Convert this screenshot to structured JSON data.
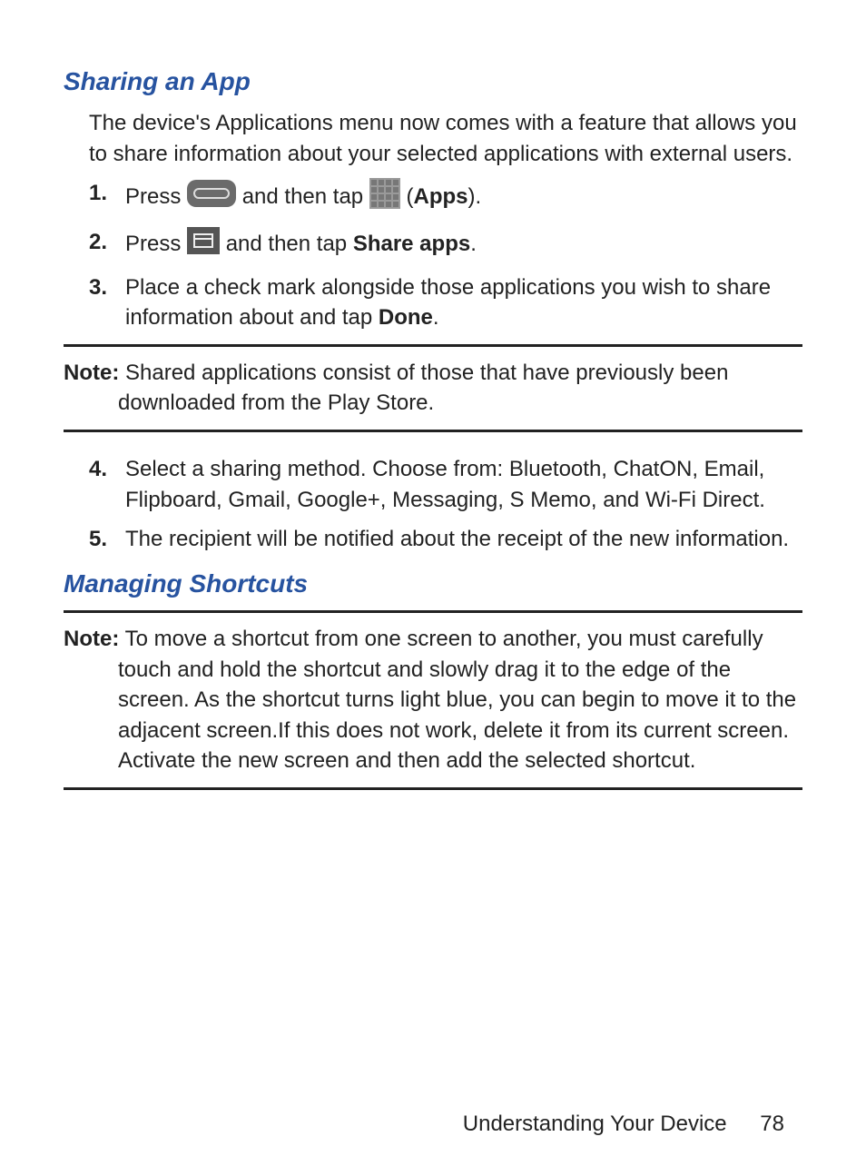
{
  "section1": {
    "title": "Sharing an App",
    "intro": "The device's Applications menu now comes with a feature that allows you to share information about your selected applications with external users.",
    "step1_a": "Press ",
    "step1_b": " and then tap ",
    "step1_c": " (",
    "step1_apps": "Apps",
    "step1_d": ").",
    "step2_a": "Press ",
    "step2_b": " and then tap ",
    "step2_share": "Share apps",
    "step2_c": ".",
    "step3_a": "Place a check mark alongside those applications you wish to share information about and tap ",
    "step3_done": "Done",
    "step3_b": ".",
    "note_label": "Note:",
    "note_body": " Shared applications consist of those that have previously been downloaded from the Play Store.",
    "step4": "Select a sharing method. Choose from: Bluetooth, ChatON, Email, Flipboard, Gmail, Google+, Messaging, S Memo, and Wi-Fi Direct.",
    "step5": "The recipient will be notified about the receipt of the new information."
  },
  "section2": {
    "title": "Managing Shortcuts",
    "note_label": "Note:",
    "note_body": " To move a shortcut from one screen to another, you must carefully touch and hold the shortcut and slowly drag it to the edge of the screen. As the shortcut turns light blue, you can begin to move it to the adjacent screen.If this does not work, delete it from its current screen. Activate the new screen and then add the selected shortcut."
  },
  "footer": {
    "chapter": "Understanding Your Device",
    "page": "78"
  },
  "nums": {
    "n1": "1.",
    "n2": "2.",
    "n3": "3.",
    "n4": "4.",
    "n5": "5."
  }
}
